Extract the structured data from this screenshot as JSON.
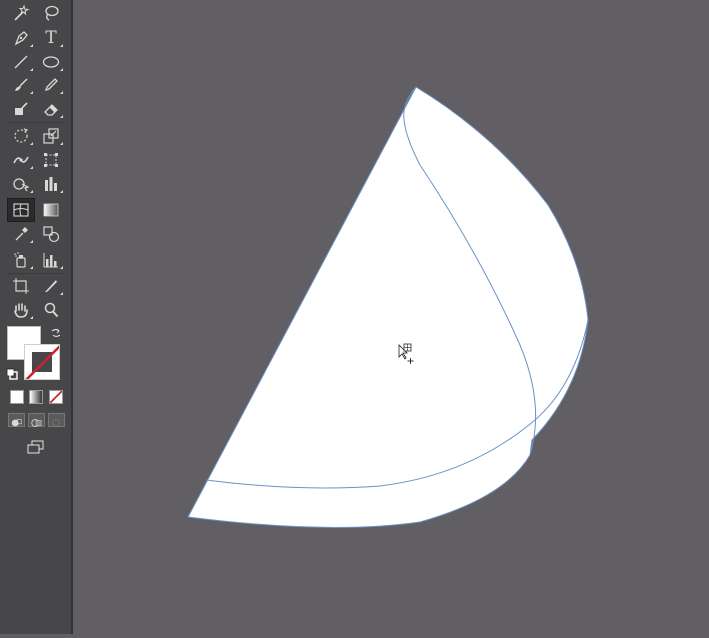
{
  "app": {
    "canvas_background": "#615f63",
    "toolbar_background": "#474648",
    "path_stroke_color": "#6b93c4",
    "shape_fill_color": "#ffffff"
  },
  "tools": [
    {
      "id": "magic-wand",
      "icon": "magic-wand-icon",
      "corner": false
    },
    {
      "id": "lasso",
      "icon": "lasso-icon",
      "corner": false
    },
    {
      "id": "pen",
      "icon": "pen-icon",
      "corner": true
    },
    {
      "id": "type",
      "icon": "type-icon",
      "label": "T",
      "corner": true
    },
    {
      "id": "line-segment",
      "icon": "line-icon",
      "corner": true
    },
    {
      "id": "ellipse",
      "icon": "ellipse-icon",
      "corner": true
    },
    {
      "id": "paintbrush",
      "icon": "paintbrush-icon",
      "corner": true
    },
    {
      "id": "pencil",
      "icon": "pencil-icon",
      "corner": true
    },
    {
      "id": "blob-brush",
      "icon": "blob-brush-icon",
      "corner": false
    },
    {
      "id": "eraser",
      "icon": "eraser-icon",
      "corner": true
    },
    {
      "id": "rotate",
      "icon": "rotate-icon",
      "corner": true
    },
    {
      "id": "scale",
      "icon": "scale-icon",
      "corner": true
    },
    {
      "id": "width",
      "icon": "width-icon",
      "corner": true
    },
    {
      "id": "free-transform",
      "icon": "free-transform-icon",
      "corner": false
    },
    {
      "id": "shape-builder",
      "icon": "shape-builder-icon",
      "corner": true
    },
    {
      "id": "graph",
      "icon": "column-graph-icon",
      "corner": true
    },
    {
      "id": "mesh",
      "icon": "mesh-icon",
      "active": true,
      "corner": false
    },
    {
      "id": "gradient",
      "icon": "gradient-icon",
      "corner": false
    },
    {
      "id": "eyedropper",
      "icon": "eyedropper-icon",
      "corner": true
    },
    {
      "id": "blend",
      "icon": "blend-icon",
      "corner": false
    },
    {
      "id": "symbol-sprayer",
      "icon": "symbol-sprayer-icon",
      "corner": true
    },
    {
      "id": "column-graph",
      "icon": "bar-graph-icon",
      "corner": true
    },
    {
      "id": "artboard",
      "icon": "artboard-icon",
      "corner": false
    },
    {
      "id": "slice",
      "icon": "slice-icon",
      "corner": true
    },
    {
      "id": "hand",
      "icon": "hand-icon",
      "corner": true
    },
    {
      "id": "zoom",
      "icon": "zoom-icon",
      "corner": false
    }
  ],
  "swatches": {
    "fill": "#ffffff",
    "stroke": "none"
  }
}
